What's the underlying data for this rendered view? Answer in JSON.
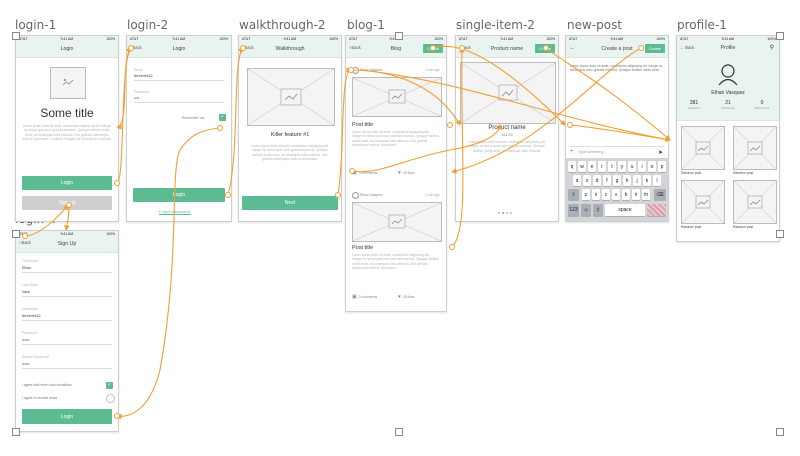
{
  "artboards": {
    "login1": "login-1",
    "login2": "login-2",
    "walkthrough2": "walkthrough-2",
    "blog1": "blog-1",
    "singleitem2": "single-item-2",
    "newpost": "new-post",
    "profile1": "profile-1",
    "login4": "login-4"
  },
  "status": {
    "carrier": "AT&T",
    "time": "9:41 AM",
    "battery": "100%"
  },
  "login1": {
    "title": "Login",
    "heading": "Some title",
    "body": "Lorem ipsum dolor sit amet, consectetur adipiscing elit. Integer ac lectus quis nunc gravida euismod. Quisque facilisis mollis tortor, at consequat nulla vehicula. Sed gravida ullamcorper ante eu accumsan. Curabitur feugiat erat sit amet orci volutpat.",
    "login_btn": "Login",
    "signup_btn": "Sign up"
  },
  "login2": {
    "back": "Back",
    "title": "Login",
    "email_lbl": "Email",
    "email_val": "ibenedek22",
    "pass_lbl": "Password",
    "pass_val": "••••",
    "remember": "Remember me",
    "login_btn": "Login",
    "forgot": "Forgot password?"
  },
  "walkthrough2": {
    "back": "Back",
    "title": "Walkthrough",
    "heading": "Killer feature #1",
    "body": "Lorem ipsum dolor sit amet, consectetur adipiscing elit. Integer ac lectus quis nunc gravida euismod. Quisque facilisis mollis tortor, at consequat nulla vehicula. Sed gravida ullamcorper ante eu accumsan.",
    "next_btn": "Next"
  },
  "blog1": {
    "back": "Back",
    "title": "Blog",
    "create": "Create",
    "author": "Ethan Vasquez",
    "time": "2 min ago",
    "post_title": "Post title",
    "post_body": "Lorem ipsum dolor sit amet, consectetur adipiscing elit. Integer ac lectus quis nunc gravida euismod. Quisque facilisis mollis tortor, at consequat nulla vehicula. Sed gravida ullamcorper ante eu accumsan.",
    "comments": "3 comments",
    "likes": "15 likes"
  },
  "singleitem2": {
    "back": "Back",
    "title": "Product name",
    "create": "Create",
    "name": "Product name",
    "price": "$14.99",
    "body": "Lorem ipsum dolor sit amet, consectetur adipiscing elit. Integer ac lectus quis nunc gravida euismod. Quisque facilisis mollis tortor, at consequat nulla vehicula."
  },
  "newpost": {
    "title": "Create a post",
    "create": "Create",
    "body": "Lorem ipsum dolor sit amet, consectetur adipiscing elit. Integer ac lectus quis nunc gravida euismod. Quisque facilisis mollis tortor.",
    "input_ph": "Type something...",
    "keys_row1": [
      "q",
      "w",
      "e",
      "r",
      "t",
      "y",
      "u",
      "i",
      "o",
      "p"
    ],
    "keys_row2": [
      "a",
      "s",
      "d",
      "f",
      "g",
      "h",
      "j",
      "k",
      "l"
    ],
    "keys_row3": [
      "z",
      "x",
      "c",
      "v",
      "b",
      "n",
      "m"
    ],
    "num_key": "123",
    "space_key": "space"
  },
  "profile1": {
    "back": "Back",
    "title": "Profile",
    "name": "Ethan Vasquez",
    "stats": [
      {
        "n": "381",
        "l": "Followers"
      },
      {
        "n": "21",
        "l": "Following"
      },
      {
        "n": "0",
        "l": "Blog Posts"
      }
    ],
    "tiles": [
      "Random post",
      "Random post",
      "Random post",
      "Random post"
    ]
  },
  "login4": {
    "back": "Back",
    "title": "Sign Up",
    "fields": [
      {
        "l": "First Name",
        "v": "Ethan"
      },
      {
        "l": "Last Name",
        "v": "Vass"
      },
      {
        "l": "Username",
        "v": "ibenedek22"
      },
      {
        "l": "Password",
        "v": "••••••"
      },
      {
        "l": "Repeat Password",
        "v": "••••••"
      }
    ],
    "terms": "I agree with terms and conditions",
    "newsletter": "I agree to receive news",
    "login_btn": "Login"
  },
  "colors": {
    "accent": "#5dbb93",
    "arrow": "#f0a030",
    "header_bg": "#e9f3ef"
  }
}
